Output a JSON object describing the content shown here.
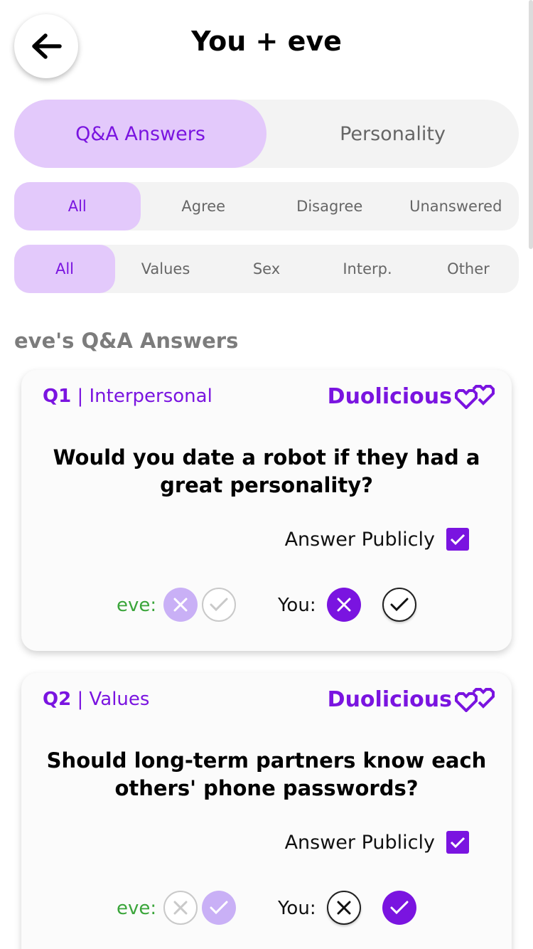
{
  "header": {
    "title": "You + eve",
    "back_icon": "arrow-left-icon"
  },
  "main_tabs": [
    {
      "label": "Q&A Answers",
      "active": true
    },
    {
      "label": "Personality",
      "active": false
    }
  ],
  "answer_filters": [
    {
      "label": "All",
      "active": true
    },
    {
      "label": "Agree",
      "active": false
    },
    {
      "label": "Disagree",
      "active": false
    },
    {
      "label": "Unanswered",
      "active": false
    }
  ],
  "category_filters": [
    {
      "label": "All",
      "active": true
    },
    {
      "label": "Values",
      "active": false
    },
    {
      "label": "Sex",
      "active": false
    },
    {
      "label": "Interp.",
      "active": false
    },
    {
      "label": "Other",
      "active": false
    }
  ],
  "section_title": "eve's Q&A Answers",
  "questions": [
    {
      "number": "Q1",
      "category": " | Interpersonal",
      "brand": "Duolicious",
      "question": "Would you date a robot if they had a great personality?",
      "answer_publicly_label": "Answer Publicly",
      "answer_publicly_checked": true,
      "eve_label": "eve:",
      "you_label": "You:",
      "eve_answer": "no",
      "you_answer": "no"
    },
    {
      "number": "Q2",
      "category": " | Values",
      "brand": "Duolicious",
      "question": "Should long-term partners know each others' phone passwords?",
      "answer_publicly_label": "Answer Publicly",
      "answer_publicly_checked": true,
      "eve_label": "eve:",
      "you_label": "You:",
      "eve_answer": "yes",
      "you_answer": "yes"
    }
  ],
  "colors": {
    "accent": "#7a14e0",
    "accent_light": "#e3c9fb",
    "eve_label": "#3aa53a",
    "muted_text": "#7c7c7c"
  }
}
